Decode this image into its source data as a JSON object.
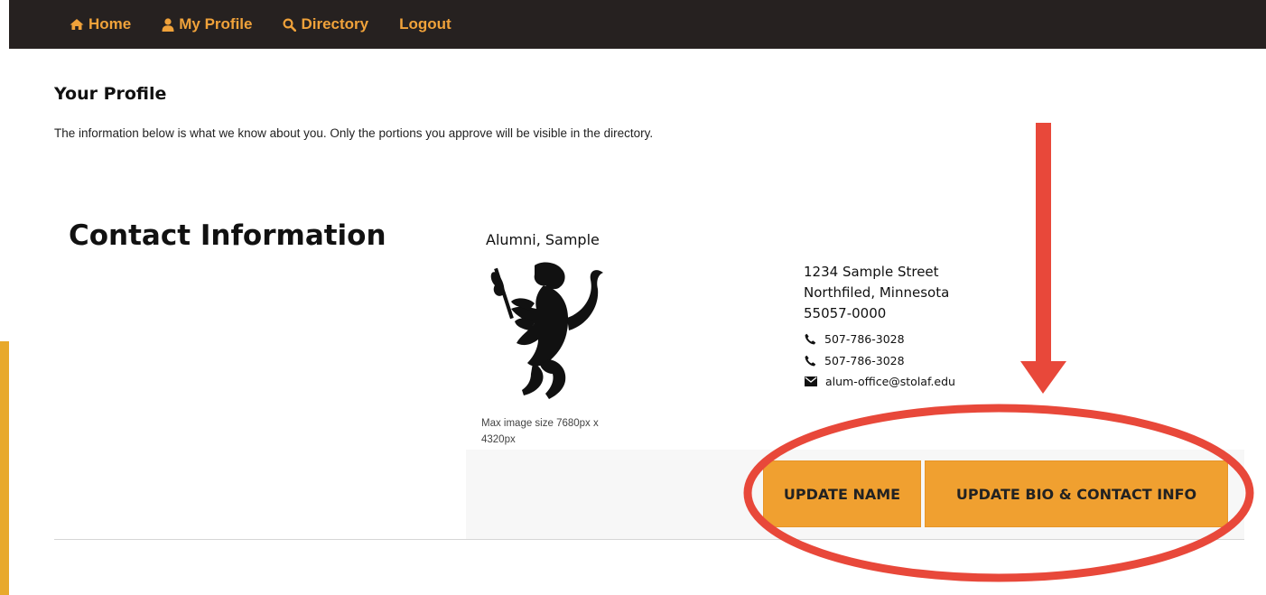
{
  "nav": {
    "home": "Home",
    "my_profile": "My Profile",
    "directory": "Directory",
    "logout": "Logout"
  },
  "page": {
    "title": "Your Profile",
    "intro": "The information below is what we know about you. Only the portions you approve will be visible in the directory."
  },
  "contact": {
    "heading": "Contact Information",
    "name": "Alumni, Sample",
    "photo_note": "Max image size 7680px x 4320px",
    "address_line1": "1234 Sample Street",
    "address_line2": "Northfiled, Minnesota",
    "address_line3": "55057-0000",
    "phone1": "507-786-3028",
    "phone2": "507-786-3028",
    "email": "alum-office@stolaf.edu"
  },
  "buttons": {
    "update_name": "UPDATE NAME",
    "update_bio": "UPDATE BIO & CONTACT INFO"
  },
  "colors": {
    "nav_bg": "#262120",
    "nav_text": "#f0a23a",
    "button_bg": "#f0a030",
    "annotation": "#e8483a",
    "left_accent": "#e8a92b"
  },
  "icons": {
    "home": "home-icon",
    "profile": "user-icon",
    "directory": "search-icon",
    "phone": "phone-icon",
    "email": "envelope-icon",
    "photo": "lion-rampant-silhouette"
  }
}
